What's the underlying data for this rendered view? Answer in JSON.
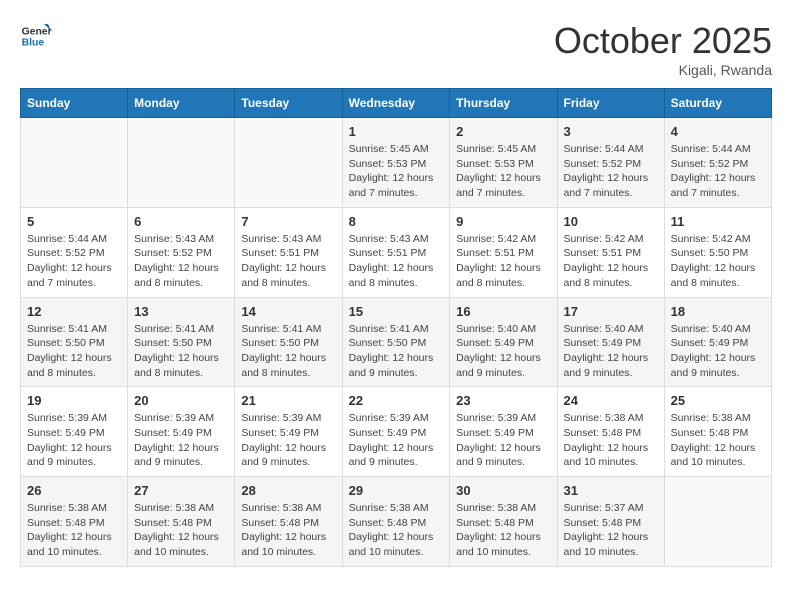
{
  "header": {
    "logo_line1": "General",
    "logo_line2": "Blue",
    "month": "October 2025",
    "location": "Kigali, Rwanda"
  },
  "days_of_week": [
    "Sunday",
    "Monday",
    "Tuesday",
    "Wednesday",
    "Thursday",
    "Friday",
    "Saturday"
  ],
  "weeks": [
    [
      {
        "day": "",
        "info": ""
      },
      {
        "day": "",
        "info": ""
      },
      {
        "day": "",
        "info": ""
      },
      {
        "day": "1",
        "info": "Sunrise: 5:45 AM\nSunset: 5:53 PM\nDaylight: 12 hours\nand 7 minutes."
      },
      {
        "day": "2",
        "info": "Sunrise: 5:45 AM\nSunset: 5:53 PM\nDaylight: 12 hours\nand 7 minutes."
      },
      {
        "day": "3",
        "info": "Sunrise: 5:44 AM\nSunset: 5:52 PM\nDaylight: 12 hours\nand 7 minutes."
      },
      {
        "day": "4",
        "info": "Sunrise: 5:44 AM\nSunset: 5:52 PM\nDaylight: 12 hours\nand 7 minutes."
      }
    ],
    [
      {
        "day": "5",
        "info": "Sunrise: 5:44 AM\nSunset: 5:52 PM\nDaylight: 12 hours\nand 7 minutes."
      },
      {
        "day": "6",
        "info": "Sunrise: 5:43 AM\nSunset: 5:52 PM\nDaylight: 12 hours\nand 8 minutes."
      },
      {
        "day": "7",
        "info": "Sunrise: 5:43 AM\nSunset: 5:51 PM\nDaylight: 12 hours\nand 8 minutes."
      },
      {
        "day": "8",
        "info": "Sunrise: 5:43 AM\nSunset: 5:51 PM\nDaylight: 12 hours\nand 8 minutes."
      },
      {
        "day": "9",
        "info": "Sunrise: 5:42 AM\nSunset: 5:51 PM\nDaylight: 12 hours\nand 8 minutes."
      },
      {
        "day": "10",
        "info": "Sunrise: 5:42 AM\nSunset: 5:51 PM\nDaylight: 12 hours\nand 8 minutes."
      },
      {
        "day": "11",
        "info": "Sunrise: 5:42 AM\nSunset: 5:50 PM\nDaylight: 12 hours\nand 8 minutes."
      }
    ],
    [
      {
        "day": "12",
        "info": "Sunrise: 5:41 AM\nSunset: 5:50 PM\nDaylight: 12 hours\nand 8 minutes."
      },
      {
        "day": "13",
        "info": "Sunrise: 5:41 AM\nSunset: 5:50 PM\nDaylight: 12 hours\nand 8 minutes."
      },
      {
        "day": "14",
        "info": "Sunrise: 5:41 AM\nSunset: 5:50 PM\nDaylight: 12 hours\nand 8 minutes."
      },
      {
        "day": "15",
        "info": "Sunrise: 5:41 AM\nSunset: 5:50 PM\nDaylight: 12 hours\nand 9 minutes."
      },
      {
        "day": "16",
        "info": "Sunrise: 5:40 AM\nSunset: 5:49 PM\nDaylight: 12 hours\nand 9 minutes."
      },
      {
        "day": "17",
        "info": "Sunrise: 5:40 AM\nSunset: 5:49 PM\nDaylight: 12 hours\nand 9 minutes."
      },
      {
        "day": "18",
        "info": "Sunrise: 5:40 AM\nSunset: 5:49 PM\nDaylight: 12 hours\nand 9 minutes."
      }
    ],
    [
      {
        "day": "19",
        "info": "Sunrise: 5:39 AM\nSunset: 5:49 PM\nDaylight: 12 hours\nand 9 minutes."
      },
      {
        "day": "20",
        "info": "Sunrise: 5:39 AM\nSunset: 5:49 PM\nDaylight: 12 hours\nand 9 minutes."
      },
      {
        "day": "21",
        "info": "Sunrise: 5:39 AM\nSunset: 5:49 PM\nDaylight: 12 hours\nand 9 minutes."
      },
      {
        "day": "22",
        "info": "Sunrise: 5:39 AM\nSunset: 5:49 PM\nDaylight: 12 hours\nand 9 minutes."
      },
      {
        "day": "23",
        "info": "Sunrise: 5:39 AM\nSunset: 5:49 PM\nDaylight: 12 hours\nand 9 minutes."
      },
      {
        "day": "24",
        "info": "Sunrise: 5:38 AM\nSunset: 5:48 PM\nDaylight: 12 hours\nand 10 minutes."
      },
      {
        "day": "25",
        "info": "Sunrise: 5:38 AM\nSunset: 5:48 PM\nDaylight: 12 hours\nand 10 minutes."
      }
    ],
    [
      {
        "day": "26",
        "info": "Sunrise: 5:38 AM\nSunset: 5:48 PM\nDaylight: 12 hours\nand 10 minutes."
      },
      {
        "day": "27",
        "info": "Sunrise: 5:38 AM\nSunset: 5:48 PM\nDaylight: 12 hours\nand 10 minutes."
      },
      {
        "day": "28",
        "info": "Sunrise: 5:38 AM\nSunset: 5:48 PM\nDaylight: 12 hours\nand 10 minutes."
      },
      {
        "day": "29",
        "info": "Sunrise: 5:38 AM\nSunset: 5:48 PM\nDaylight: 12 hours\nand 10 minutes."
      },
      {
        "day": "30",
        "info": "Sunrise: 5:38 AM\nSunset: 5:48 PM\nDaylight: 12 hours\nand 10 minutes."
      },
      {
        "day": "31",
        "info": "Sunrise: 5:37 AM\nSunset: 5:48 PM\nDaylight: 12 hours\nand 10 minutes."
      },
      {
        "day": "",
        "info": ""
      }
    ]
  ]
}
